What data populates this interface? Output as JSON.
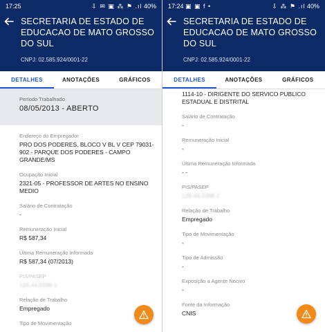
{
  "left": {
    "status": {
      "time": "17:25",
      "icons": "⇩ ✉ ▣ ⁂ ⚑ .ıl",
      "battery": "40%"
    },
    "title": "SECRETARIA DE ESTADO DE EDUCACAO DE MATO GROSSO DO SUL",
    "cnpj": "CNPJ: 02.585.924/0001-22",
    "tabs": [
      "DETALHES",
      "ANOTAÇÕES",
      "GRÁFICOS"
    ],
    "highlight": {
      "label": "Período Trabalhado",
      "value": "08/05/2013 - ABERTO"
    },
    "fields": [
      {
        "label": "Endereço do Empregador",
        "value": "PRO DOS PODERES, BLOCO V BL V CEP 79031-902 - PARQUE DOS PODERES - CAMPO GRANDE/MS"
      },
      {
        "label": "Ocupação Inicial",
        "value": "2321-05 - PROFESSOR DE ARTES NO ENSINO MEDIO"
      },
      {
        "label": "Salário de Contratação",
        "value": "-"
      },
      {
        "label": "Remuneração Inicial",
        "value": "R$ 587,34"
      },
      {
        "label": "Última Remuneração Informada",
        "value": "R$ 587,34 (07/2013)"
      },
      {
        "label": "PIS/PASEP",
        "value": "128.44.0398-1"
      },
      {
        "label": "Relação de Trabalho",
        "value": "Empregado"
      },
      {
        "label": "Tipo de Movimentação",
        "value": ""
      }
    ]
  },
  "right": {
    "status": {
      "time": "17:24",
      "icons": "▣ ▣ f •",
      "icons2": "⇩ ⁂ ⚑ .ıl",
      "battery": "40%"
    },
    "title": "SECRETARIA DE ESTADO DE EDUCACAO DE MATO GROSSO DO SUL",
    "cnpj": "CNPJ: 02.585.924/0001-22",
    "tabs": [
      "DETALHES",
      "ANOTAÇÕES",
      "GRÁFICOS"
    ],
    "top_value": "1114-10 - DIRIGENTE DO SERVICO PUBLICO ESTADUAL E DISTRITAL",
    "fields": [
      {
        "label": "Salário de Contratação",
        "value": "-"
      },
      {
        "label": "Remuneração Inicial",
        "value": "-"
      },
      {
        "label": "Última Remuneração Informada",
        "value": "- -"
      },
      {
        "label": "PIS/PASEP",
        "value": "128.44.0398-1"
      },
      {
        "label": "Relação de Trabalho",
        "value": "Empregado"
      },
      {
        "label": "Tipo de Movimentação",
        "value": "-"
      },
      {
        "label": "Tipo de Admissão",
        "value": "-"
      },
      {
        "label": "Exposição a Agente Nocivo",
        "value": "-"
      },
      {
        "label": "Fonte da Informação",
        "value": "CNIS"
      }
    ]
  },
  "colors": {
    "appbar": "#0b2a66",
    "accent": "#1d57c7",
    "fab": "#f28a1a"
  },
  "icons": {
    "back": "arrow-left-icon",
    "fab": "warning-icon"
  }
}
